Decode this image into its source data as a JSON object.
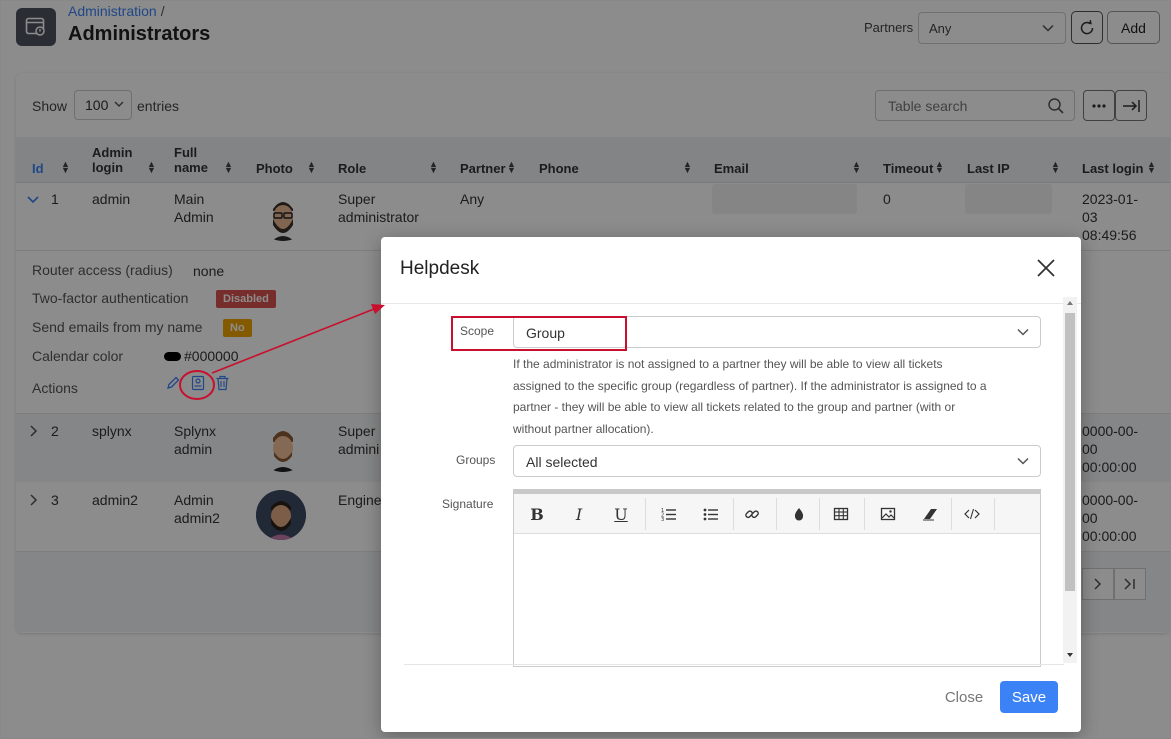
{
  "header": {
    "breadcrumb": "Administration",
    "breadcrumb_sep": "/",
    "title": "Administrators",
    "partners_label": "Partners",
    "partners_value": "Any",
    "add_label": "Add"
  },
  "toolbar": {
    "show_label": "Show",
    "show_value": "100",
    "entries_label": "entries",
    "search_placeholder": "Table search"
  },
  "table": {
    "columns": [
      {
        "key": "id",
        "label": "Id"
      },
      {
        "key": "login",
        "label": "Admin login"
      },
      {
        "key": "name",
        "label": "Full name"
      },
      {
        "key": "photo",
        "label": "Photo"
      },
      {
        "key": "role",
        "label": "Role"
      },
      {
        "key": "partner",
        "label": "Partner"
      },
      {
        "key": "phone",
        "label": "Phone"
      },
      {
        "key": "email",
        "label": "Email"
      },
      {
        "key": "timeout",
        "label": "Timeout"
      },
      {
        "key": "last_ip",
        "label": "Last IP"
      },
      {
        "key": "last_login",
        "label": "Last login"
      }
    ],
    "rows": [
      {
        "id": "1",
        "login": "admin",
        "name": "Main Admin",
        "role": "Super administrator",
        "partner": "Any",
        "timeout": "0",
        "last_login": "2023-01-03 08:49:56",
        "expanded": true
      },
      {
        "id": "2",
        "login": "splynx",
        "name": "Splynx admin",
        "role": "Super admini",
        "last_login": "0000-00-00 00:00:00",
        "expanded": false
      },
      {
        "id": "3",
        "login": "admin2",
        "name": "Admin admin2",
        "role": "Engine",
        "last_login": "0000-00-00 00:00:00",
        "expanded": false
      }
    ],
    "details": {
      "router_access_label": "Router access (radius)",
      "router_access_value": "none",
      "two_factor_label": "Two-factor authentication",
      "two_factor_badge": "Disabled",
      "send_emails_label": "Send emails from my name",
      "send_emails_badge": "No",
      "calendar_color_label": "Calendar color",
      "calendar_color_value": "#000000",
      "actions_label": "Actions"
    }
  },
  "colors": {
    "accent": "#3b82f6",
    "danger": "#d9534f",
    "warning": "#f0a500",
    "annotation": "#c8102e"
  },
  "modal": {
    "title": "Helpdesk",
    "scope_label": "Scope",
    "scope_value": "Group",
    "help_lines": [
      "If the administrator is not assigned to a partner they will be able to view all tickets",
      "assigned to the specific group (regardless of partner). If the administrator is assigned to a",
      "partner - they will be able to view all tickets related to the group and partner (with or",
      "without partner allocation)."
    ],
    "groups_label": "Groups",
    "groups_value": "All selected",
    "signature_label": "Signature",
    "editor_tools": [
      "bold-icon",
      "italic-icon",
      "underline-icon",
      "ordered-list-icon",
      "unordered-list-icon",
      "link-icon",
      "color-drop-icon",
      "table-icon",
      "image-icon",
      "eraser-icon",
      "code-view-icon"
    ],
    "close_label": "Close",
    "save_label": "Save"
  }
}
